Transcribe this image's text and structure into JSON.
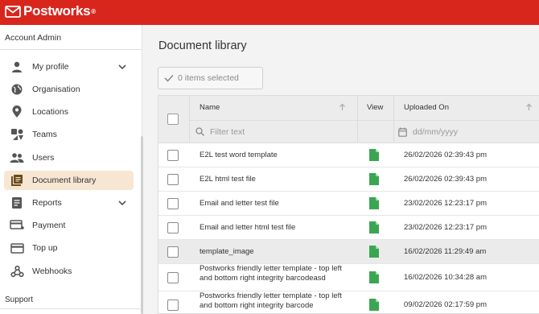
{
  "brand": {
    "name": "Postworks",
    "reg": "®"
  },
  "sidebar": {
    "section_title": "Account Admin",
    "items": [
      {
        "label": "My profile",
        "icon": "person-icon",
        "chevron": true
      },
      {
        "label": "Organisation",
        "icon": "globe-icon"
      },
      {
        "label": "Locations",
        "icon": "map-pin-icon"
      },
      {
        "label": "Teams",
        "icon": "teams-icon"
      },
      {
        "label": "Users",
        "icon": "users-icon"
      },
      {
        "label": "Document library",
        "icon": "document-library-icon",
        "active": true
      },
      {
        "label": "Reports",
        "icon": "reports-icon",
        "chevron": true
      },
      {
        "label": "Payment",
        "icon": "payment-card-icon"
      },
      {
        "label": "Top up",
        "icon": "top-up-card-icon"
      },
      {
        "label": "Webhooks",
        "icon": "webhooks-icon"
      }
    ],
    "support_label": "Support"
  },
  "main": {
    "title": "Document library",
    "selection_label": "0 items selected"
  },
  "grid": {
    "columns": {
      "name": "Name",
      "view": "View",
      "uploaded": "Uploaded On"
    },
    "filters": {
      "name_placeholder": "Filter text",
      "date_placeholder": "dd/mm/yyyy"
    },
    "rows": [
      {
        "name": "E2L test word template",
        "uploaded": "26/02/2026 02:39:43 pm"
      },
      {
        "name": "E2L html test file",
        "uploaded": "26/02/2026 02:39:43 pm"
      },
      {
        "name": "Email and letter test file",
        "uploaded": "23/02/2026 12:23:17 pm"
      },
      {
        "name": "Email and letter html test file",
        "uploaded": "23/02/2026 12:23:17 pm"
      },
      {
        "name": "template_image",
        "uploaded": "16/02/2026 11:29:49 am",
        "highlighted": true
      },
      {
        "name": "Postworks friendly letter template - top left and bottom right integrity barcodeasd",
        "uploaded": "16/02/2026 10:34:28 am"
      },
      {
        "name": "Postworks friendly letter template - top left and bottom right integrity barcode",
        "uploaded": "09/02/2026 02:17:59 pm"
      }
    ]
  },
  "colors": {
    "brand_red": "#d9261c",
    "active_bg": "#f7e6d2",
    "doc_green": "#3aa652"
  }
}
